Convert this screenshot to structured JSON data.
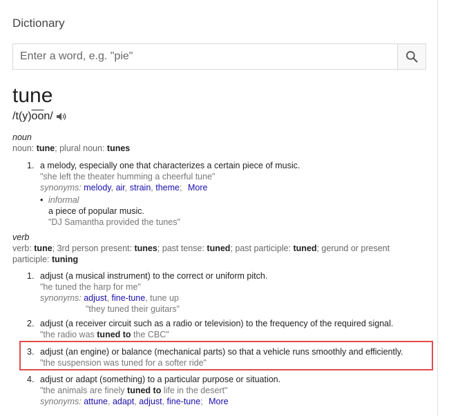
{
  "header": {
    "title": "Dictionary"
  },
  "search": {
    "placeholder": "Enter a word, e.g. \"pie\""
  },
  "entry": {
    "word": "tune",
    "phonetic_prefix": "/t(y)",
    "phonetic_overline": "oo",
    "phonetic_suffix": "n/"
  },
  "noun": {
    "pos": "noun",
    "forms": {
      "label": "noun: ",
      "form1": "tune",
      "sep1": "; plural noun: ",
      "form2": "tunes"
    },
    "senses": [
      {
        "num": "1.",
        "definition": "a melody, especially one that characterizes a certain piece of music.",
        "example": "\"she left the theater humming a cheerful tune\"",
        "synonyms_label": "synonyms:",
        "synonyms": [
          "melody",
          "air",
          "strain",
          "theme"
        ],
        "more": "More"
      }
    ],
    "subsense": {
      "bullet": "•",
      "label": "informal",
      "definition": "a piece of popular music.",
      "example": "\"DJ Samantha provided the tunes\""
    }
  },
  "verb": {
    "pos": "verb",
    "forms": {
      "l1": "verb: ",
      "f1": "tune",
      "l2": "; 3rd person present: ",
      "f2": "tunes",
      "l3": "; past tense: ",
      "f3": "tuned",
      "l4": "; past participle: ",
      "f4": "tuned",
      "l5": "; gerund or present participle: ",
      "f5": "tuning"
    },
    "senses": [
      {
        "num": "1.",
        "definition": "adjust (a musical instrument) to the correct or uniform pitch.",
        "example": "\"he tuned the harp for me\"",
        "synonyms_label": "synonyms:",
        "syn1": "adjust",
        "syn2": "fine-tune",
        "syn3": "tune up",
        "syn_example": "\"they tuned their guitars\""
      },
      {
        "num": "2.",
        "definition": "adjust (a receiver circuit such as a radio or television) to the frequency of the required signal.",
        "example_pre": "\"the radio was ",
        "example_bold": "tuned to",
        "example_post": " the CBC\""
      },
      {
        "num": "3.",
        "definition": "adjust (an engine) or balance (mechanical parts) so that a vehicle runs smoothly and efficiently.",
        "example": "\"the suspension was tuned for a softer ride\""
      },
      {
        "num": "4.",
        "definition": "adjust or adapt (something) to a particular purpose or situation.",
        "example_pre": "\"the animals are finely ",
        "example_bold": "tuned to",
        "example_post": " life in the desert\"",
        "synonyms_label": "synonyms:",
        "synonyms": [
          "attune",
          "adapt",
          "adjust",
          "fine-tune"
        ],
        "more": "More"
      }
    ]
  },
  "colors": {
    "highlight": "#e34b4b",
    "link": "#1a0dab",
    "muted": "#777777"
  },
  "icons": {
    "search": "search-icon",
    "speaker": "speaker-icon"
  }
}
